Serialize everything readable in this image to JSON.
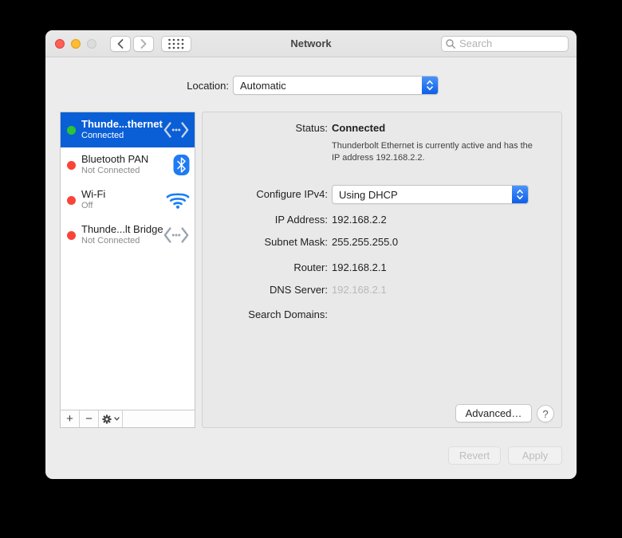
{
  "window": {
    "title": "Network"
  },
  "toolbar": {
    "search_placeholder": "Search"
  },
  "location": {
    "label": "Location:",
    "value": "Automatic"
  },
  "sidebar": {
    "items": [
      {
        "name": "Thunde...thernet",
        "status": "Connected",
        "dot": "green",
        "icon": "thunderbolt-ethernet",
        "selected": true
      },
      {
        "name": "Bluetooth PAN",
        "status": "Not Connected",
        "dot": "red",
        "icon": "bluetooth",
        "selected": false
      },
      {
        "name": "Wi-Fi",
        "status": "Off",
        "dot": "red",
        "icon": "wifi",
        "selected": false
      },
      {
        "name": "Thunde...lt Bridge",
        "status": "Not Connected",
        "dot": "red",
        "icon": "thunderbolt-bridge",
        "selected": false
      }
    ],
    "actions": {
      "add": "+",
      "remove": "−"
    }
  },
  "panel": {
    "status_label": "Status:",
    "status_value": "Connected",
    "status_description": "Thunderbolt Ethernet is currently active and has the IP address 192.168.2.2.",
    "configure_ipv4": {
      "label": "Configure IPv4:",
      "value": "Using DHCP"
    },
    "fields": [
      {
        "label": "IP Address:",
        "value": "192.168.2.2",
        "muted": false
      },
      {
        "label": "Subnet Mask:",
        "value": "255.255.255.0",
        "muted": false
      },
      {
        "label": "Router:",
        "value": "192.168.2.1",
        "muted": false
      },
      {
        "label": "DNS Server:",
        "value": "192.168.2.1",
        "muted": true
      },
      {
        "label": "Search Domains:",
        "value": "",
        "muted": false
      }
    ],
    "advanced_label": "Advanced…",
    "help_label": "?"
  },
  "footer": {
    "revert_label": "Revert",
    "apply_label": "Apply"
  },
  "icons": {
    "search-icon": "magnifier",
    "back-icon": "chevron-left",
    "forward-icon": "chevron-right",
    "show-all-icon": "dot-grid",
    "stepper-icon": "up-down-chevrons",
    "thunderbolt-icon": "angle-brackets-with-dots",
    "bluetooth-icon": "bluetooth-rune",
    "wifi-icon": "wifi-arcs",
    "gear-icon": "gear-with-chevron",
    "help-icon": "question-mark",
    "status-dot": "filled-circle"
  },
  "colors": {
    "selection_blue": "#0a5fd7",
    "status_green": "#2ac535",
    "status_red": "#f94438",
    "icon_blue": "#1a7ff5",
    "stepper_blue_light": "#4a93fb",
    "stepper_blue_dark": "#0d5fe8",
    "close_red": "#ff5f57",
    "minimize_yellow": "#febc2e",
    "disabled_gray": "#dcdcdc"
  }
}
